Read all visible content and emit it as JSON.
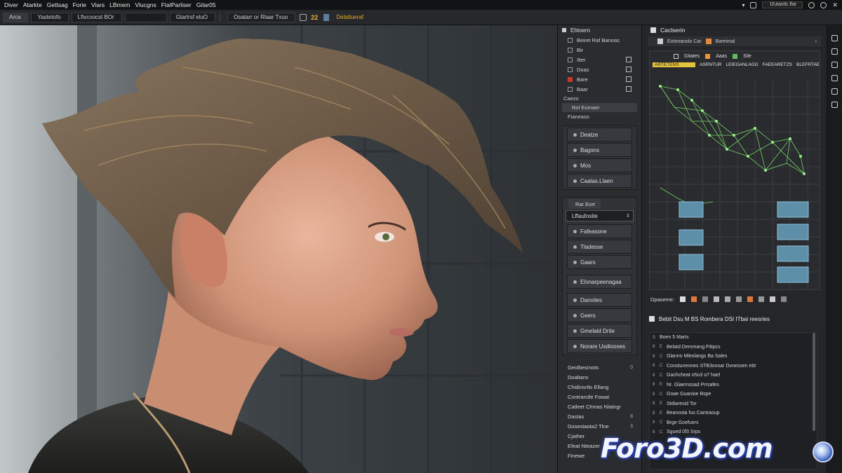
{
  "menubar": {
    "items": [
      "Diver",
      "Atarkte",
      "Gettsag",
      "Forie",
      "Viars",
      "LBmem",
      "Vlucgns",
      "FtalParliser",
      "Gitar05"
    ],
    "search_text": "t2utastlc.flar"
  },
  "tabs": {
    "items": [
      "Arca",
      "Yastetofo",
      "Lfivcoocst BOr",
      "",
      "Gtarlrsf eluO"
    ],
    "viewport_label": "Osatarr or Rlaar Txuo",
    "frame_number": "22",
    "status_label": "Delatlueraf"
  },
  "outliner": {
    "header": "Ehtoern",
    "rows": [
      {
        "label": "Beiret Raf Banoas",
        "icon": "check"
      },
      {
        "label": "Bir",
        "icon": "check"
      },
      {
        "label": "Ilter",
        "icon": "add"
      },
      {
        "label": "Doas",
        "icon": "folder"
      },
      {
        "label": "Bare",
        "icon": "red"
      },
      {
        "label": "Baar",
        "icon": "box"
      }
    ],
    "sub_items": [
      "Caezo",
      "Rol Eomaer",
      "Fianeaso"
    ],
    "buttons": [
      "Deatze",
      "Bagons",
      "Mos",
      "Caalas.Llaen"
    ],
    "group_title": "Rar Eort",
    "dropdown_value": "Lffaufosite",
    "options": [
      "Fafeasone",
      "Tladesse",
      "Gaars",
      "Elonarpeenagaa",
      "Danvites",
      "Geers",
      "Gmelald Drite",
      "Norare Usdiooses"
    ],
    "bottom_list": [
      {
        "label": "Geolbesmots",
        "num": "0"
      },
      {
        "label": "Doaltans",
        "num": ""
      },
      {
        "label": "Chidinsrtlo Ellang",
        "num": ""
      },
      {
        "label": "Contrarctle Fowat",
        "num": ""
      },
      {
        "label": "Catleet Chmas Nlatirgr",
        "num": ""
      },
      {
        "label": "Dastas",
        "num": "8"
      },
      {
        "label": "Dosestaota2 Tlne",
        "num": "3"
      },
      {
        "label": "Cjather",
        "num": ""
      },
      {
        "label": "Efeat Nteazer",
        "num": ""
      },
      {
        "label": "Finewe",
        "num": ""
      }
    ]
  },
  "rightpanel": {
    "title": "Caclserin",
    "toolbar_text": "Eotonanolo Car",
    "toolbar_text2": "Bareimal",
    "node_tools": [
      "Gitates",
      "Aaas",
      "Sile"
    ],
    "node_labels": [
      "ARTETENS PNOEOGS",
      "ASRNTUR",
      "LEIEGANLAGG",
      "FAEEARETZS",
      "BLEFRTAE"
    ],
    "display_label": "Dpaseme:",
    "section_title": "Bebit Dsu M BS Rombera DSI ITbai reesries",
    "layers": [
      "Boen 5 Marts",
      "Belatd Demmang Fittpcs",
      "Glanno Mleolangs Ba Sales",
      "Conotunennes STB3snoar Dvnessen ettr",
      "Gachcheat o5o3 o7 hael",
      "Nr. Glaernssad Prrsafes",
      "Goae Guanioe Bspe",
      "Stdiaresid Tor",
      "Beanosta fus Cantraoup",
      "Brge Goefuers",
      "Sgued 0f3 Srps"
    ]
  },
  "watermark": "Foro3D.com",
  "colors": {
    "accent": "#f2b233",
    "mesh": "#7de36a",
    "node": "#5d8fa8"
  }
}
